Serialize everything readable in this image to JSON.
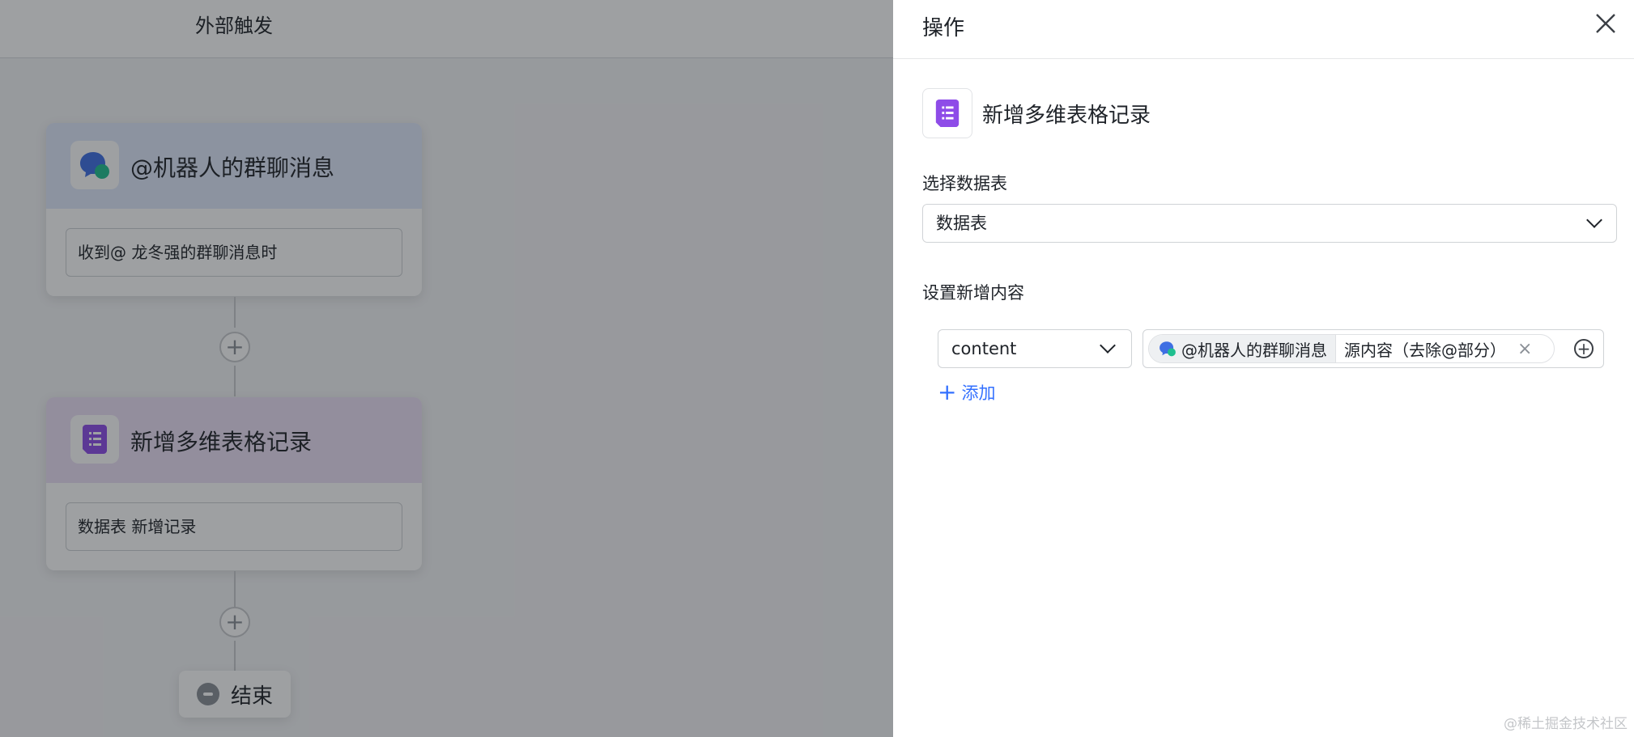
{
  "canvas": {
    "header_title": "外部触发",
    "trigger_card": {
      "title": "@机器人的群聊消息",
      "field": "收到@ 龙冬强的群聊消息时"
    },
    "action_card": {
      "title": "新增多维表格记录",
      "field": "数据表 新增记录"
    },
    "end_label": "结束"
  },
  "drawer": {
    "title": "操作",
    "action_name": "新增多维表格记录",
    "select_table_label": "选择数据表",
    "select_table_value": "数据表",
    "set_content_label": "设置新增内容",
    "field_name": "content",
    "token_source": "@机器人的群聊消息",
    "token_field": "源内容（去除@部分）",
    "add_label": "添加"
  },
  "watermark": "@稀土掘金技术社区",
  "colors": {
    "accent": "#3370ff",
    "base_purple": "#8e4ce8",
    "chat_blue": "#3f6fe3",
    "chat_green": "#1fbf8f"
  }
}
